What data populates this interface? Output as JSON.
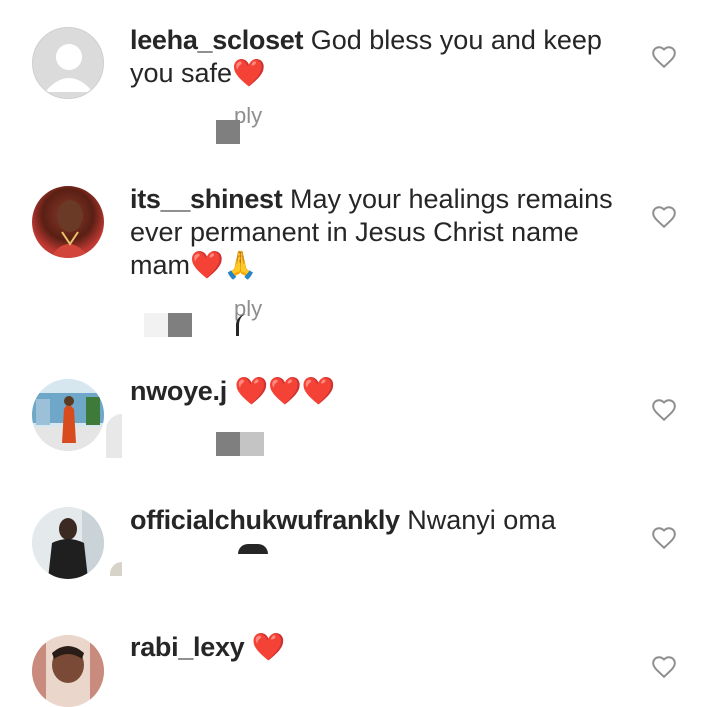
{
  "comments": [
    {
      "username": "leeha_scloset",
      "text": "God bless you and keep you safe",
      "emoji": "❤️",
      "reply_label": "ply"
    },
    {
      "username": "its__shinest",
      "text": "May your healings remains ever permanent in Jesus Christ name mam",
      "emoji": "❤️🙏",
      "reply_label": "ply"
    },
    {
      "username": "nwoye.j",
      "text": "",
      "emoji": "❤️❤️❤️",
      "reply_label": ""
    },
    {
      "username": "officialchukwufrankly",
      "text": "Nwanyi oma",
      "emoji": "",
      "reply_label": ""
    },
    {
      "username": "rabi_lexy",
      "text": "",
      "emoji": "❤️",
      "reply_label": ""
    }
  ],
  "icons": {
    "like": "heart-outline-icon",
    "avatar_default": "default-avatar-icon"
  },
  "colors": {
    "text": "#262626",
    "secondary": "#8e8e8e",
    "heart_emoji": "#e0202f"
  }
}
